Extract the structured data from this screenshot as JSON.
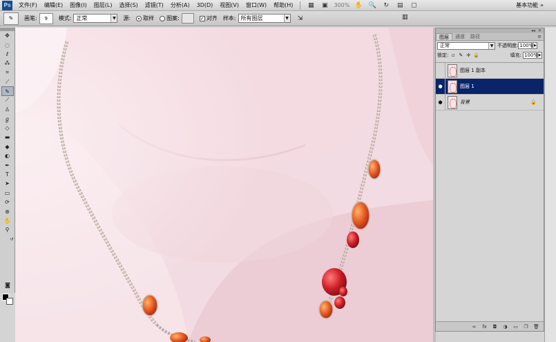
{
  "app": {
    "logo": "Ps"
  },
  "menu": {
    "items": [
      "文件(F)",
      "编辑(E)",
      "图像(I)",
      "图层(L)",
      "选择(S)",
      "滤镜(T)",
      "分析(A)",
      "3D(D)",
      "视图(V)",
      "窗口(W)",
      "帮助(H)"
    ],
    "zoom": "300%",
    "workspace": "基本功能"
  },
  "options": {
    "brush_label": "画笔:",
    "brush_size": "9",
    "mode_label": "模式:",
    "mode_value": "正常",
    "source_label": "源:",
    "sampled_label": "取样",
    "pattern_label": "图案:",
    "aligned_label": "对齐",
    "aligned_checked": "✓",
    "sample_label": "样本:",
    "sample_value": "所有图层"
  },
  "layers_panel": {
    "tabs": [
      "图层",
      "通道",
      "路径"
    ],
    "blend_mode": "正常",
    "opacity_label": "不透明度:",
    "opacity": "100%",
    "lock_label": "锁定:",
    "fill_label": "填充:",
    "fill": "100%",
    "layers": [
      {
        "name": "图层 1 副本",
        "visible": false,
        "selected": false,
        "locked": false
      },
      {
        "name": "图层 1",
        "visible": true,
        "selected": true,
        "locked": false
      },
      {
        "name": "背景",
        "visible": true,
        "selected": false,
        "locked": true
      }
    ]
  },
  "colors": {
    "foreground": "#000000",
    "background": "#ffffff",
    "selection": "#0a246a"
  }
}
